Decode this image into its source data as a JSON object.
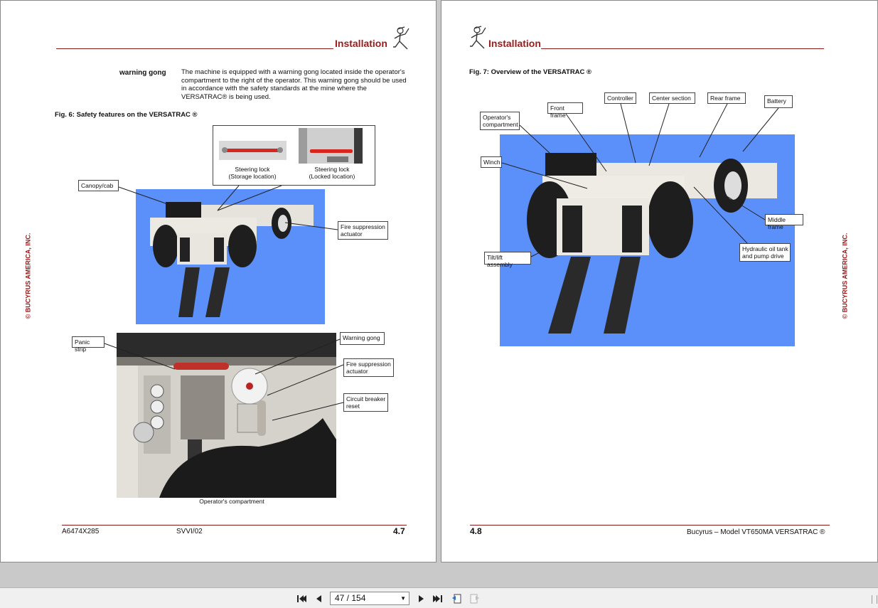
{
  "left_page": {
    "header_title": "Installation",
    "intro": {
      "term": "warning gong",
      "body": "The machine is equipped with a warning gong located inside the operator's compartment to the right of the operator.  This warning gong should be used in accordance with the safety standards at the mine where the VERSATRAC® is being used."
    },
    "fig6_title": "Fig. 6: Safety features on the VERSATRAC ®",
    "callouts_top": {
      "steering_storage": "Steering lock\n(Storage location)",
      "steering_locked": "Steering lock\n(Locked location)",
      "canopy": "Canopy/cab",
      "fire1": "Fire suppression\nactuator"
    },
    "callouts_bottom": {
      "panic": "Panic strip",
      "gong": "Warning gong",
      "fire2": "Fire suppression\nactuator",
      "breaker": "Circuit breaker\nreset",
      "caption": "Operator's compartment"
    },
    "side_copyright": "© BUCYRUS AMERICA, INC.",
    "footer": {
      "doc": "A6474X285",
      "rev": "SVVI/02",
      "page": "4.7"
    }
  },
  "right_page": {
    "header_title": "Installation",
    "fig7_title": "Fig. 7: Overview of the VERSATRAC ®",
    "callouts": {
      "operator": "Operator's\ncompartment",
      "front_frame": "Front frame",
      "controller": "Controller",
      "center": "Center section",
      "rear": "Rear frame",
      "battery": "Battery",
      "winch": "Winch",
      "middle": "Middle frame",
      "hydraulic": "Hydraulic oil tank\nand pump drive",
      "tilt": "Tilt/lift assembly"
    },
    "side_copyright": "© BUCYRUS AMERICA, INC.",
    "footer": {
      "page": "4.8",
      "model": "Bucyrus –  Model VT650MA VERSATRAC ®"
    }
  },
  "toolbar": {
    "page_indicator": "47 / 154",
    "buttons": [
      "first-page-icon",
      "prev-page-icon",
      "next-page-icon",
      "last-page-icon",
      "previous-view-icon",
      "next-view-icon"
    ]
  },
  "colors": {
    "accent_red": "#9b1b1b",
    "photo_blue": "#5b8ff9",
    "toolbar_bg": "#f0f0f0",
    "desk_bg": "#c9c9c9"
  }
}
